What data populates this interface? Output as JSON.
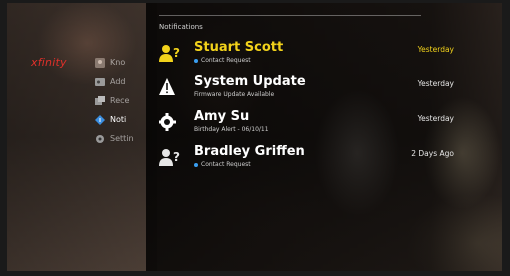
{
  "brand": "xfinity",
  "sidebar": {
    "items": [
      {
        "label": "Kno",
        "icon": "avatar-icon"
      },
      {
        "label": "Add",
        "icon": "contact-card-icon"
      },
      {
        "label": "Rece",
        "icon": "recent-calls-icon"
      },
      {
        "label": "Noti",
        "icon": "info-icon",
        "active": true
      },
      {
        "label": "Settin",
        "icon": "gear-icon"
      }
    ]
  },
  "panel": {
    "title": "Notifications"
  },
  "notifications": [
    {
      "title": "Stuart Scott",
      "subtitle": "Contact Request",
      "time": "Yesterday",
      "icon": "contact-request-icon",
      "selected": true
    },
    {
      "title": "System Update",
      "subtitle": "Firmware Update Available",
      "time": "Yesterday",
      "icon": "warning-icon"
    },
    {
      "title": "Amy Su",
      "subtitle": "Birthday Alert - 06/10/11",
      "time": "Yesterday",
      "icon": "birthday-gear-icon"
    },
    {
      "title": "Bradley Griffen",
      "subtitle": "Contact Request",
      "time": "2 Days Ago",
      "icon": "contact-request-icon"
    }
  ],
  "colors": {
    "brand": "#e0302a",
    "selected": "#f2d21b",
    "status_dot": "#3a9ef0"
  }
}
